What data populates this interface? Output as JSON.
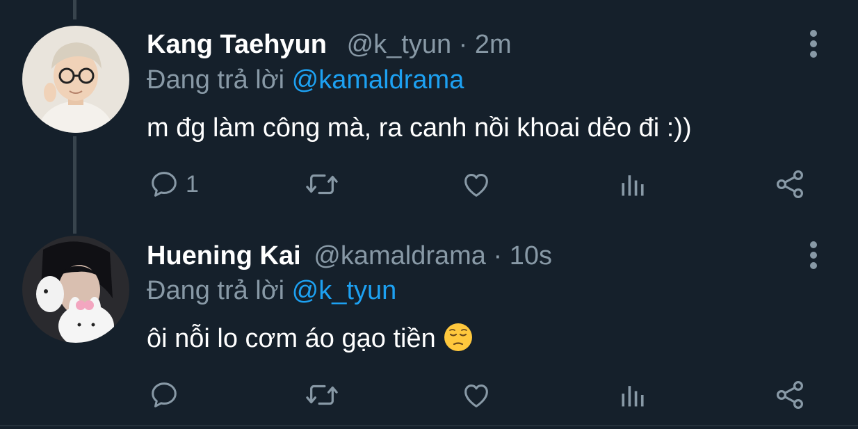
{
  "tweets": [
    {
      "name": "Kang Taehyun",
      "handle": "@k_tyun",
      "separator": "·",
      "time": "2m",
      "reply_prefix": "Đang trả lời",
      "reply_to": "@kamaldrama",
      "text": "m đg làm công mà, ra canh nồi khoai dẻo đi :))",
      "reply_count": "1",
      "avatar_icon": "profile-photo-icon"
    },
    {
      "name": "Huening Kai",
      "handle": "@kamaldrama",
      "separator": "·",
      "time": "10s",
      "reply_prefix": "Đang trả lời",
      "reply_to": "@k_tyun",
      "text": "ôi nỗi lo cơm áo gạo tiền",
      "emoji": "pensive-face-emoji",
      "reply_count": "",
      "avatar_icon": "profile-photo-icon"
    }
  ],
  "colors": {
    "background": "#15202b",
    "primary_text": "#ffffff",
    "secondary_text": "#8899a6",
    "accent": "#1da1f2",
    "divider": "#38444d"
  },
  "icons": [
    "reply-icon",
    "retweet-icon",
    "like-icon",
    "analytics-icon",
    "share-icon",
    "more-options-icon"
  ]
}
